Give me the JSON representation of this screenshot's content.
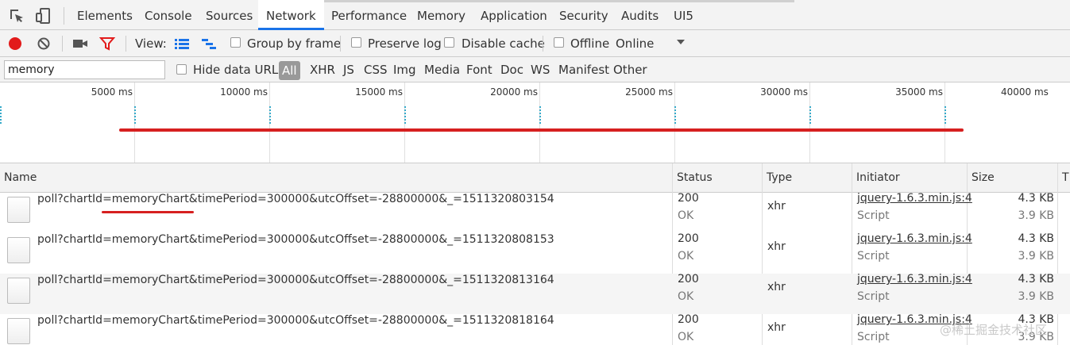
{
  "tabbar": {
    "tabs": [
      {
        "label": "Elements"
      },
      {
        "label": "Console"
      },
      {
        "label": "Sources"
      },
      {
        "label": "Network",
        "active": true
      },
      {
        "label": "Performance"
      },
      {
        "label": "Memory"
      },
      {
        "label": "Application"
      },
      {
        "label": "Security"
      },
      {
        "label": "Audits"
      },
      {
        "label": "UI5"
      }
    ],
    "icons": [
      "inspect-element-icon",
      "device-toolbar-icon"
    ]
  },
  "toolbar": {
    "view_label": "View:",
    "group_by_frame": "Group by frame",
    "preserve_log": "Preserve log",
    "disable_cache": "Disable cache",
    "offline": "Offline",
    "throttle": "Online",
    "icons": [
      "record-icon",
      "clear-icon",
      "camera-icon",
      "filter-icon",
      "large-rows-icon",
      "waterfall-icon",
      "dropdown-arrow-icon"
    ]
  },
  "filter": {
    "value": "memory",
    "hide_data_urls": "Hide data URLs",
    "types": [
      "All",
      "XHR",
      "JS",
      "CSS",
      "Img",
      "Media",
      "Font",
      "Doc",
      "WS",
      "Manifest",
      "Other"
    ]
  },
  "timeline": {
    "ticks": [
      "5000 ms",
      "10000 ms",
      "15000 ms",
      "20000 ms",
      "25000 ms",
      "30000 ms",
      "35000 ms",
      "40000 ms"
    ]
  },
  "table": {
    "columns": {
      "name": "Name",
      "status": "Status",
      "type": "Type",
      "initiator": "Initiator",
      "size": "Size",
      "time": "T"
    },
    "rows": [
      {
        "name": "poll?chartId=memoryChart&timePeriod=300000&utcOffset=-28800000&_=1511320803154",
        "status": "200",
        "status_text": "OK",
        "type": "xhr",
        "initiator": "jquery-1.6.3.min.js:4",
        "initiator_type": "Script",
        "size": "4.3 KB",
        "content": "3.9 KB"
      },
      {
        "name": "poll?chartId=memoryChart&timePeriod=300000&utcOffset=-28800000&_=1511320808153",
        "status": "200",
        "status_text": "OK",
        "type": "xhr",
        "initiator": "jquery-1.6.3.min.js:4",
        "initiator_type": "Script",
        "size": "4.3 KB",
        "content": "3.9 KB"
      },
      {
        "name": "poll?chartId=memoryChart&timePeriod=300000&utcOffset=-28800000&_=1511320813164",
        "status": "200",
        "status_text": "OK",
        "type": "xhr",
        "initiator": "jquery-1.6.3.min.js:4",
        "initiator_type": "Script",
        "size": "4.3 KB",
        "content": "3.9 KB"
      },
      {
        "name": "poll?chartId=memoryChart&timePeriod=300000&utcOffset=-28800000&_=1511320818164",
        "status": "200",
        "status_text": "OK",
        "type": "xhr",
        "initiator": "jquery-1.6.3.min.js:4",
        "initiator_type": "Script",
        "size": "4.3 KB",
        "content": "3.9 KB"
      }
    ]
  },
  "watermark": "@稀土掘金技术社区",
  "colors": {
    "accent": "#1a73e8",
    "record": "#e21b1b",
    "annotation": "#d62020",
    "timeline_blip": "#34a9c9"
  }
}
